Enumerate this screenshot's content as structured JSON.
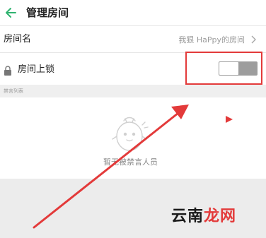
{
  "header": {
    "title": "管理房间"
  },
  "room_name": {
    "label": "房间名",
    "value": "我狠 HaPpy的房间"
  },
  "room_lock": {
    "label": "房间上锁",
    "enabled": false
  },
  "mute_list": {
    "section_label": "禁言列表",
    "empty_text": "暂无被禁言人员"
  },
  "watermark": {
    "part1": "云南",
    "part2": "龙网"
  },
  "colors": {
    "accent_green": "#2fb36f",
    "annotation_red": "#e33a3a",
    "toggle_off": "#9d9d9d"
  }
}
